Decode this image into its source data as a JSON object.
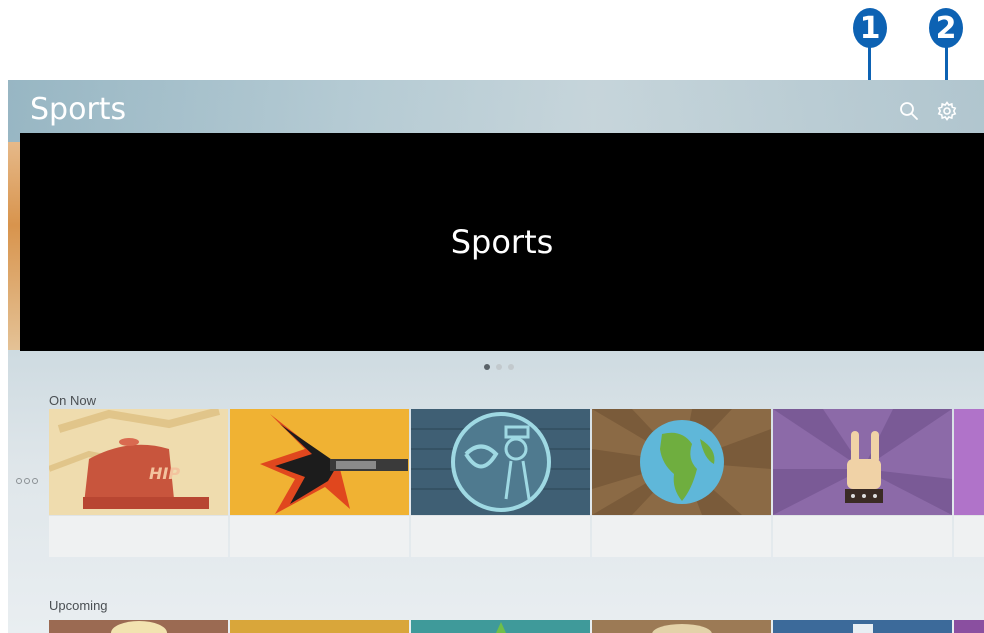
{
  "callouts": [
    "1",
    "2"
  ],
  "header": {
    "title": "Sports",
    "search_icon": "search-icon",
    "settings_icon": "gear-icon"
  },
  "hero": {
    "title": "Sports",
    "pages": 3,
    "active_page": 1
  },
  "sections": {
    "on_now": {
      "label": "On Now",
      "cards": [
        {
          "art": "cap-icon",
          "color": "#e9c879"
        },
        {
          "art": "guitar-icon",
          "color": "#f0b233"
        },
        {
          "art": "musician-icon",
          "color": "#4a6f86"
        },
        {
          "art": "globe-icon",
          "color": "#8b6a45"
        },
        {
          "art": "rock-hand-icon",
          "color": "#8c6aa8"
        },
        {
          "art": "partial",
          "color": "#b073c9"
        }
      ]
    },
    "upcoming": {
      "label": "Upcoming",
      "cards": [
        {
          "color": "#9b6a52"
        },
        {
          "color": "#d9a63a"
        },
        {
          "color": "#3f9a9a"
        },
        {
          "color": "#9c7a55"
        },
        {
          "color": "#3c6a9a"
        },
        {
          "color": "#8a4fa0"
        }
      ]
    }
  },
  "more_icon": "more-options-icon",
  "colors": {
    "callout": "#0d62b3",
    "hero_bg": "#000000"
  }
}
